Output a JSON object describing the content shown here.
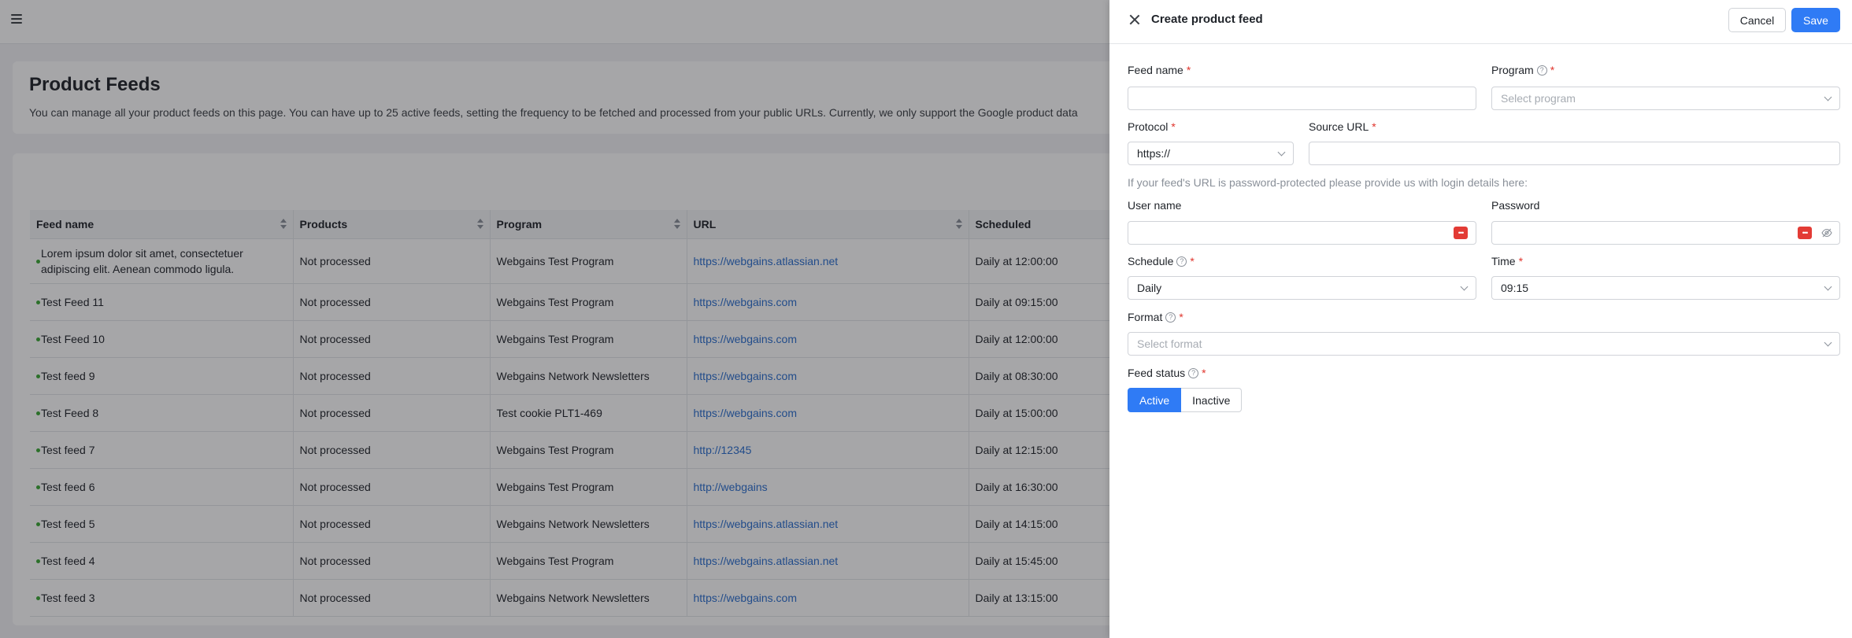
{
  "page": {
    "title": "Product Feeds",
    "description": "You can manage all your product feeds on this page. You can have up to 25 active feeds, setting the frequency to be fetched and processed from your public URLs. Currently, we only support the Google product data"
  },
  "table": {
    "columns": [
      "Feed name",
      "Products",
      "Program",
      "URL",
      "Scheduled"
    ],
    "rows": [
      {
        "name": "Lorem ipsum dolor sit amet, consectetuer adipiscing elit. Aenean commodo ligula.",
        "products": "Not processed",
        "program": "Webgains Test Program",
        "url": "https://webgains.atlassian.net",
        "scheduled": "Daily at 12:00:00"
      },
      {
        "name": "Test Feed 11",
        "products": "Not processed",
        "program": "Webgains Test Program",
        "url": "https://webgains.com",
        "scheduled": "Daily at 09:15:00"
      },
      {
        "name": "Test Feed 10",
        "products": "Not processed",
        "program": "Webgains Test Program",
        "url": "https://webgains.com",
        "scheduled": "Daily at 12:00:00"
      },
      {
        "name": "Test feed 9",
        "products": "Not processed",
        "program": "Webgains Network Newsletters",
        "url": "https://webgains.com",
        "scheduled": "Daily at 08:30:00"
      },
      {
        "name": "Test Feed 8",
        "products": "Not processed",
        "program": "Test cookie PLT1-469",
        "url": "https://webgains.com",
        "scheduled": "Daily at 15:00:00"
      },
      {
        "name": "Test feed 7",
        "products": "Not processed",
        "program": "Webgains Test Program",
        "url": "http://12345",
        "scheduled": "Daily at 12:15:00"
      },
      {
        "name": "Test feed 6",
        "products": "Not processed",
        "program": "Webgains Test Program",
        "url": "http://webgains",
        "scheduled": "Daily at 16:30:00"
      },
      {
        "name": "Test feed 5",
        "products": "Not processed",
        "program": "Webgains Network Newsletters",
        "url": "https://webgains.atlassian.net",
        "scheduled": "Daily at 14:15:00"
      },
      {
        "name": "Test feed 4",
        "products": "Not processed",
        "program": "Webgains Test Program",
        "url": "https://webgains.atlassian.net",
        "scheduled": "Daily at 15:45:00"
      },
      {
        "name": "Test feed 3",
        "products": "Not processed",
        "program": "Webgains Network Newsletters",
        "url": "https://webgains.com",
        "scheduled": "Daily at 13:15:00"
      }
    ]
  },
  "drawer": {
    "title": "Create product feed",
    "cancel_label": "Cancel",
    "save_label": "Save",
    "required_mark": "*",
    "feed_name": {
      "label": "Feed name",
      "value": ""
    },
    "program": {
      "label": "Program",
      "placeholder": "Select program"
    },
    "protocol": {
      "label": "Protocol",
      "value": "https://"
    },
    "source_url": {
      "label": "Source URL",
      "value": ""
    },
    "hint": "If your feed's URL is password-protected please provide us with login details here:",
    "username": {
      "label": "User name",
      "value": ""
    },
    "password": {
      "label": "Password",
      "value": ""
    },
    "schedule": {
      "label": "Schedule",
      "value": "Daily"
    },
    "time": {
      "label": "Time",
      "value": "09:15"
    },
    "format": {
      "label": "Format",
      "placeholder": "Select format"
    },
    "feed_status": {
      "label": "Feed status",
      "options": [
        "Active",
        "Inactive"
      ],
      "selected": "Active"
    }
  },
  "colors": {
    "primary": "#2f7bf5",
    "required": "#e0342c",
    "link": "#2b6fcf",
    "status_dot": "#3aa835",
    "keypass": "#e33b35"
  },
  "icons": [
    "menu-icon",
    "close-icon",
    "help-icon",
    "chevron-down-icon",
    "password-manager-icon",
    "eye-off-icon",
    "sort-icon"
  ]
}
